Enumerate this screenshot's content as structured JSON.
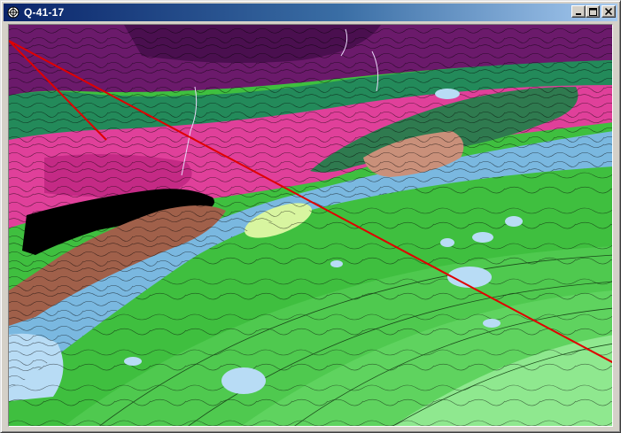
{
  "window": {
    "title": "Q-41-17",
    "icon": "map-viewer-icon",
    "buttons": {
      "minimize": "minimize-icon",
      "maximize": "maximize-icon",
      "close": "close-icon"
    }
  },
  "map": {
    "colors": {
      "upper_purple": "#6b1a6b",
      "dark_purple": "#4a0f4f",
      "magenta": "#e0409a",
      "deep_magenta": "#c42a85",
      "dark_green": "#2f7a4f",
      "teal_green": "#238a5a",
      "brown": "#a0604a",
      "tan": "#c9907a",
      "black": "#000000",
      "light_blue": "#7ab8e0",
      "pale_blue": "#b8dcf5",
      "green": "#3fbf3f",
      "mid_green": "#5fd35f",
      "light_green": "#8fe88f",
      "yellow_green": "#d8f5a0",
      "profile_line": "#e00000"
    }
  }
}
